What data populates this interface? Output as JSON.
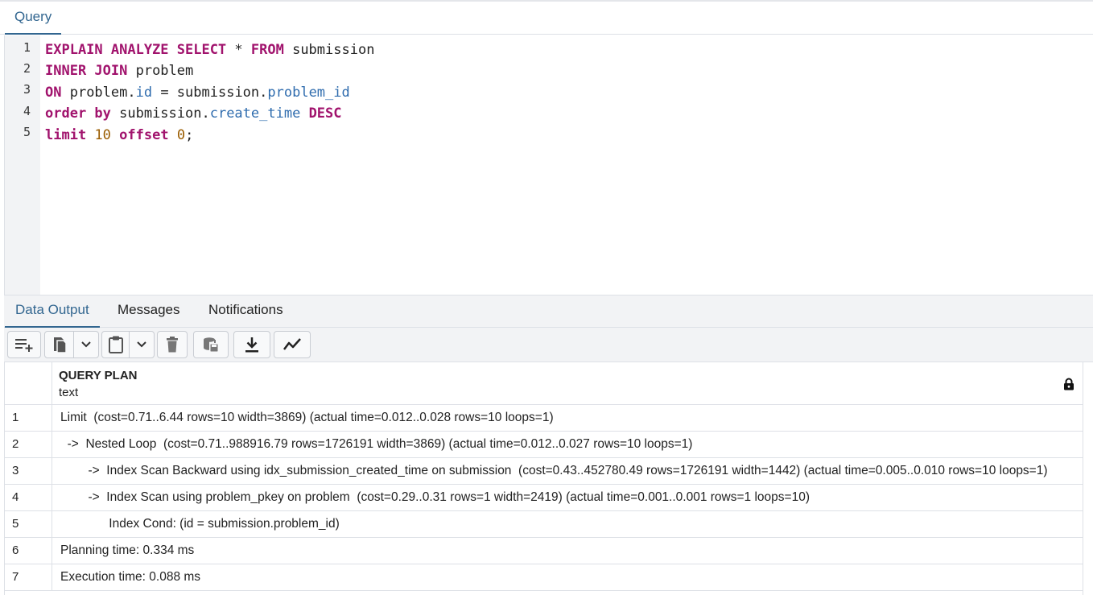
{
  "query_tab": {
    "label": "Query"
  },
  "editor": {
    "line_numbers": [
      "1",
      "2",
      "3",
      "4",
      "5"
    ],
    "lines": [
      {
        "t1": "EXPLAIN ANALYZE SELECT",
        "t2": " * ",
        "t3": "FROM",
        "t4": " submission"
      },
      {
        "t1": "INNER JOIN",
        "t2": " problem"
      },
      {
        "t1": "ON",
        "t2": " problem.",
        "t3": "id",
        "t4": " = submission.",
        "t5": "problem_id"
      },
      {
        "t1": "order by",
        "t2": " submission.",
        "t3": "create_time",
        "t4": " ",
        "t5": "DESC"
      },
      {
        "t1": "limit",
        "t2": " ",
        "t3": "10",
        "t4": " ",
        "t5": "offset",
        "t6": " ",
        "t7": "0",
        "t8": ";"
      }
    ]
  },
  "result_tabs": [
    {
      "label": "Data Output"
    },
    {
      "label": "Messages"
    },
    {
      "label": "Notifications"
    }
  ],
  "toolbar": {
    "icons": [
      "add-row-icon",
      "copy-icon",
      "chevron-down-icon",
      "paste-icon",
      "chevron-down-icon",
      "delete-icon",
      "save-data-icon",
      "download-icon",
      "graph-icon"
    ]
  },
  "grid": {
    "column": {
      "name": "QUERY PLAN",
      "type": "text"
    },
    "rows": [
      {
        "n": "1",
        "text": "Limit  (cost=0.71..6.44 rows=10 width=3869) (actual time=0.012..0.028 rows=10 loops=1)"
      },
      {
        "n": "2",
        "text": "  ->  Nested Loop  (cost=0.71..988916.79 rows=1726191 width=3869) (actual time=0.012..0.027 rows=10 loops=1)"
      },
      {
        "n": "3",
        "text": "        ->  Index Scan Backward using idx_submission_created_time on submission  (cost=0.43..452780.49 rows=1726191 width=1442) (actual time=0.005..0.010 rows=10 loops=1)"
      },
      {
        "n": "4",
        "text": "        ->  Index Scan using problem_pkey on problem  (cost=0.29..0.31 rows=1 width=2419) (actual time=0.001..0.001 rows=1 loops=10)"
      },
      {
        "n": "5",
        "text": "              Index Cond: (id = submission.problem_id)"
      },
      {
        "n": "6",
        "text": "Planning time: 0.334 ms"
      },
      {
        "n": "7",
        "text": "Execution time: 0.088 ms"
      }
    ]
  }
}
